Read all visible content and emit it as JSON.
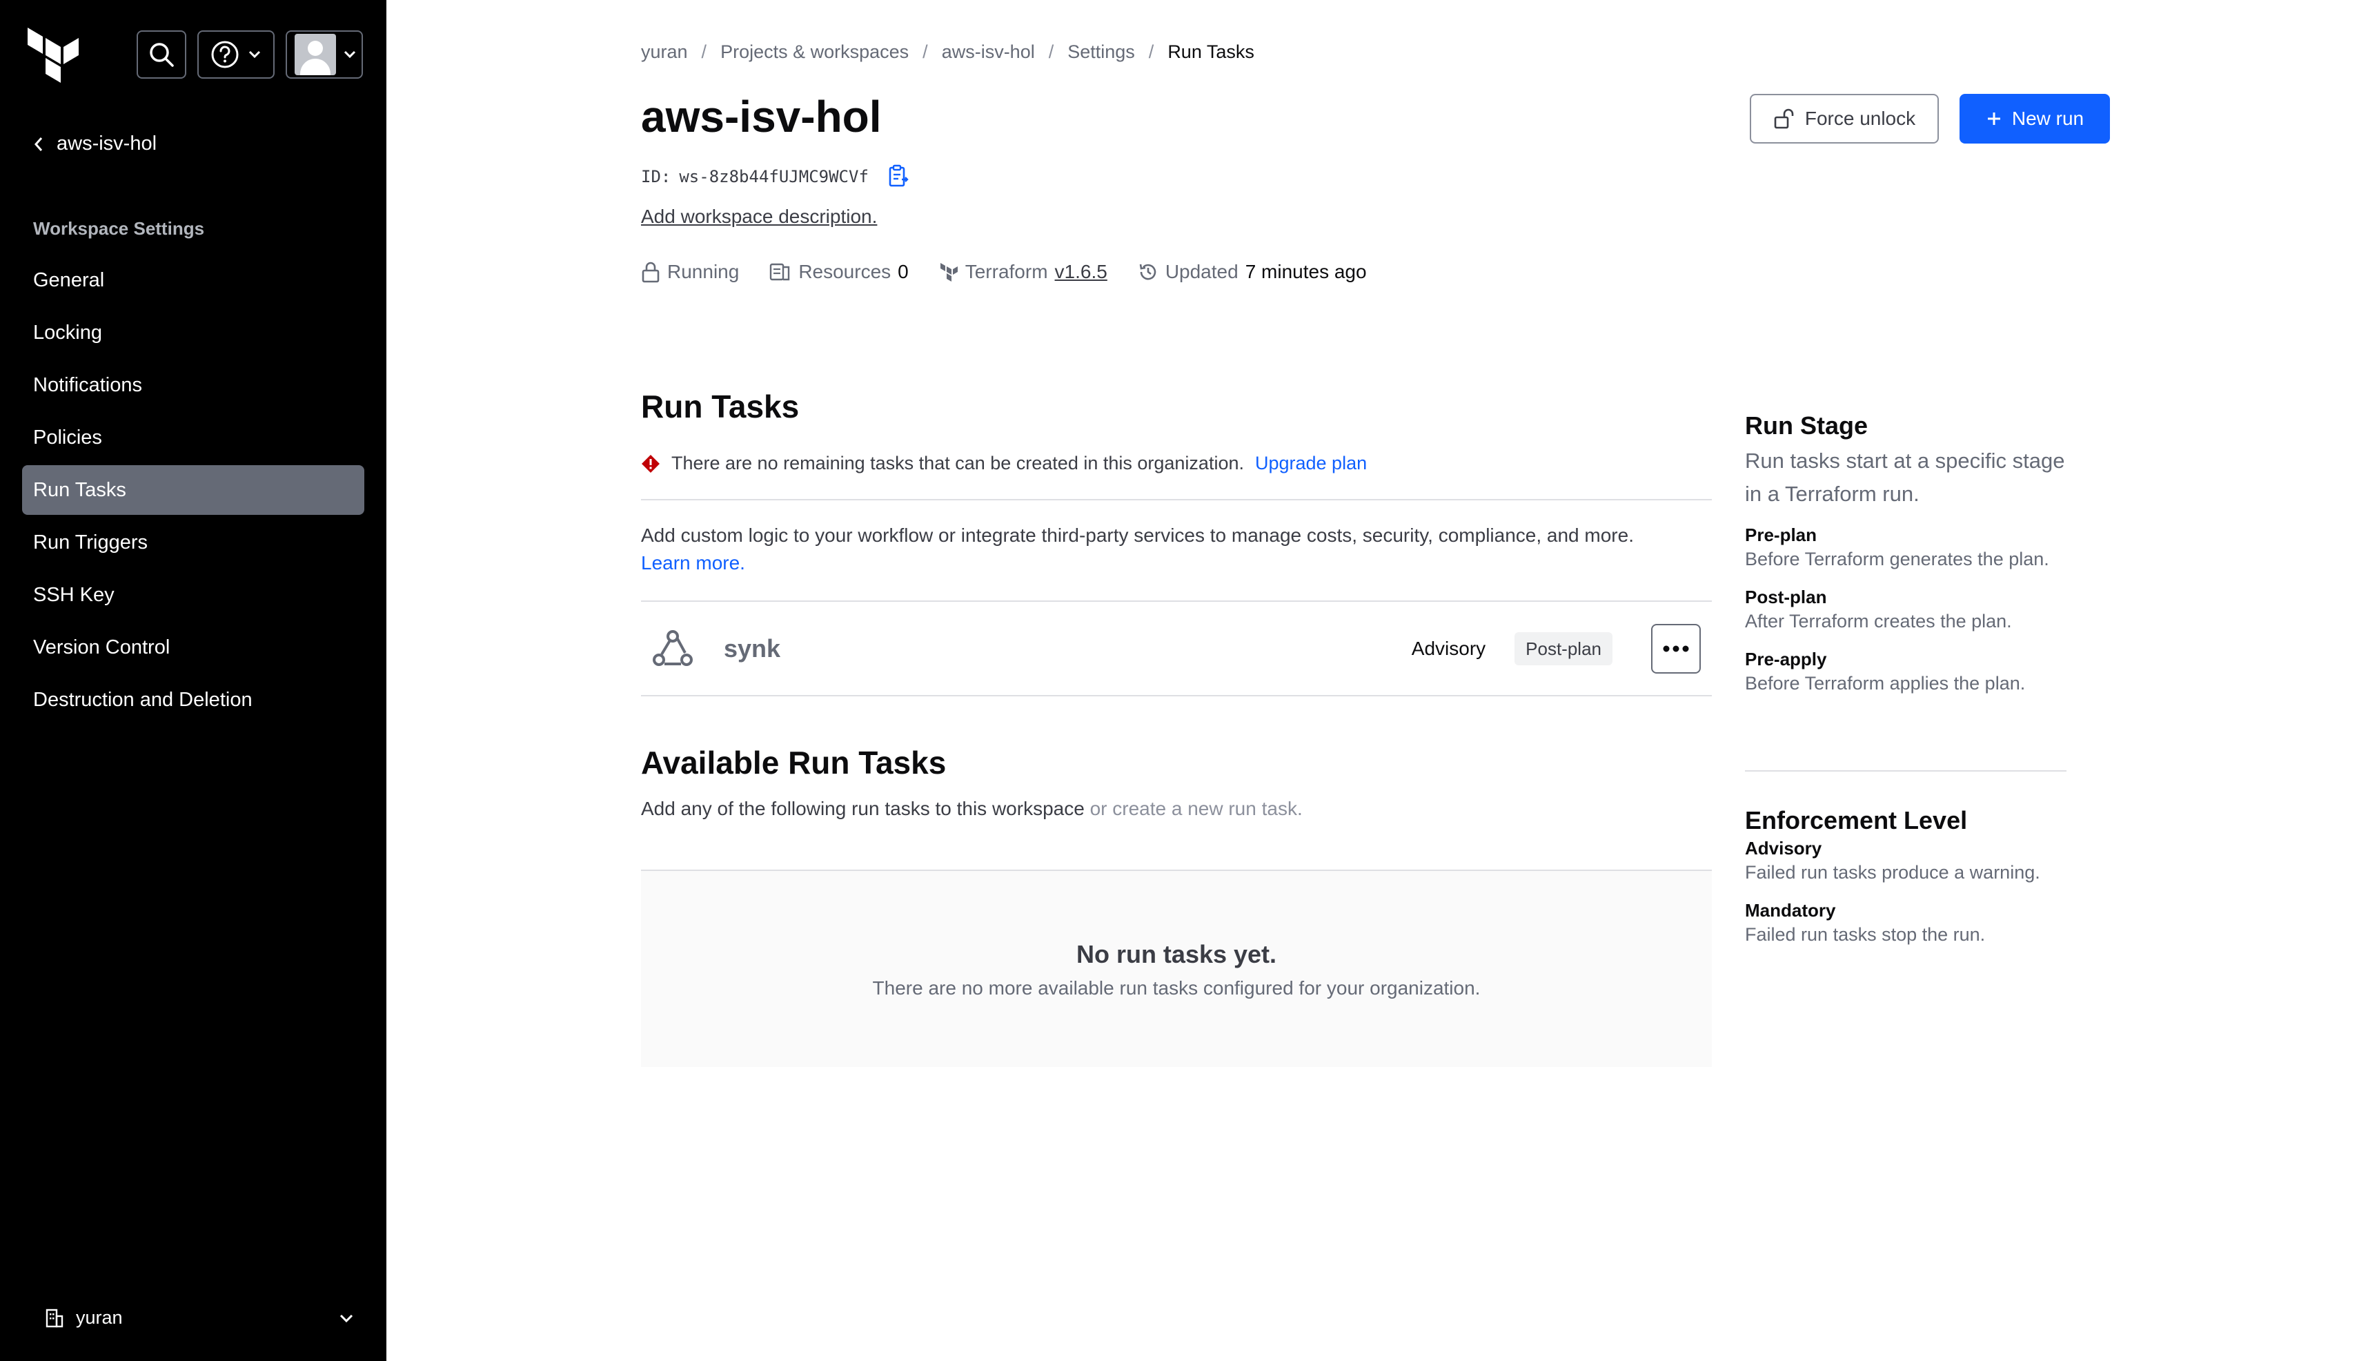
{
  "sidebar": {
    "back_label": "aws-isv-hol",
    "section_label": "Workspace Settings",
    "items": [
      {
        "label": "General"
      },
      {
        "label": "Locking"
      },
      {
        "label": "Notifications"
      },
      {
        "label": "Policies"
      },
      {
        "label": "Run Tasks",
        "active": true
      },
      {
        "label": "Run Triggers"
      },
      {
        "label": "SSH Key"
      },
      {
        "label": "Version Control"
      },
      {
        "label": "Destruction and Deletion"
      }
    ],
    "org_name": "yuran",
    "icons": [
      "terraform-logo",
      "search-icon",
      "help-icon",
      "avatar",
      "chevron-down-icon"
    ]
  },
  "breadcrumb": [
    "yuran",
    "Projects & workspaces",
    "aws-isv-hol",
    "Settings",
    "Run Tasks"
  ],
  "header": {
    "title": "aws-isv-hol",
    "force_unlock_label": "Force unlock",
    "new_run_label": "New run",
    "id_label": "ID:",
    "id_value": "ws-8z8b44fUJMC9WCVf",
    "add_description": "Add workspace description."
  },
  "meta": {
    "status": "Running",
    "resources_label": "Resources",
    "resources_count": "0",
    "terraform_label": "Terraform",
    "terraform_version": "v1.6.5",
    "updated_label": "Updated",
    "updated_value": "7 minutes ago"
  },
  "run_tasks": {
    "title": "Run Tasks",
    "alert_text": "There are no remaining tasks that can be created in this organization.",
    "alert_link": "Upgrade plan",
    "intro_text": "Add custom logic to your workflow or integrate third-party services to manage costs, security, compliance, and more.",
    "learn_more": "Learn more.",
    "tasks": [
      {
        "name": "synk",
        "enforcement": "Advisory",
        "stage": "Post-plan"
      }
    ]
  },
  "available": {
    "title": "Available Run Tasks",
    "subtitle": "Add any of the following run tasks to this workspace",
    "create_link": "or create a new run task.",
    "empty_title": "No run tasks yet.",
    "empty_desc": "There are no more available run tasks configured for your organization."
  },
  "help": {
    "stage_title": "Run Stage",
    "stage_lead": "Run tasks start at a specific stage in a Terraform run.",
    "stages": [
      {
        "term": "Pre-plan",
        "def": "Before Terraform generates the plan."
      },
      {
        "term": "Post-plan",
        "def": "After Terraform creates the plan."
      },
      {
        "term": "Pre-apply",
        "def": "Before Terraform applies the plan."
      }
    ],
    "enforcement_title": "Enforcement Level",
    "levels": [
      {
        "term": "Advisory",
        "def": "Failed run tasks produce a warning."
      },
      {
        "term": "Mandatory",
        "def": "Failed run tasks stop the run."
      }
    ]
  },
  "colors": {
    "sidebar_bg": "#000000",
    "active_item_bg": "#656a76",
    "primary": "#1060ff",
    "critical": "#c00005"
  }
}
